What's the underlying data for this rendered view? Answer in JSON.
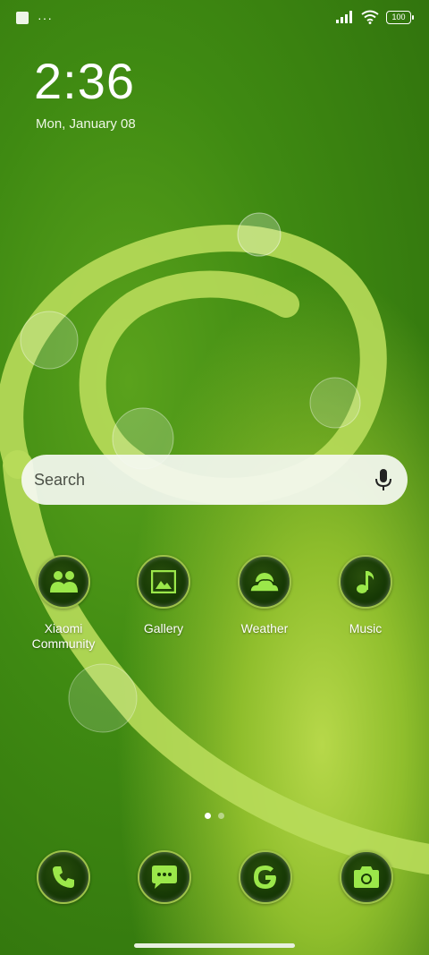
{
  "status_bar": {
    "notification_icon": "square-notification-icon",
    "overflow": "···",
    "signal_icon": "signal-icon",
    "wifi_icon": "wifi-icon",
    "battery_level": "100"
  },
  "clock": {
    "time": "2:36",
    "date": "Mon, January 08"
  },
  "search": {
    "placeholder": "Search",
    "mic_icon": "microphone-icon"
  },
  "apps": [
    {
      "label": "Xiaomi\nCommunity",
      "icon": "community-icon"
    },
    {
      "label": "Gallery",
      "icon": "gallery-icon"
    },
    {
      "label": "Weather",
      "icon": "weather-icon"
    },
    {
      "label": "Music",
      "icon": "music-note-icon"
    }
  ],
  "page_indicator": {
    "pages": 2,
    "current": 1
  },
  "dock": [
    {
      "icon": "phone-icon"
    },
    {
      "icon": "messages-icon"
    },
    {
      "icon": "google-icon"
    },
    {
      "icon": "camera-icon"
    }
  ],
  "colors": {
    "icon_green": "#9be84a",
    "icon_bg": "#173a05",
    "ring": "#9ec24a"
  }
}
